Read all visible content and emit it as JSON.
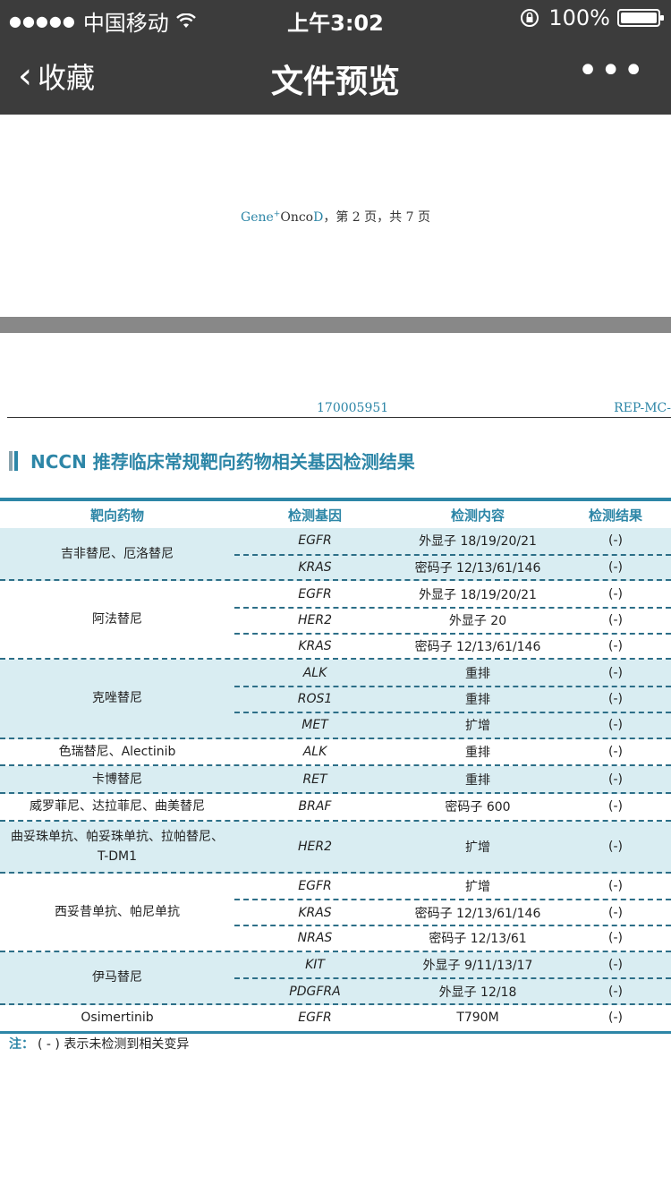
{
  "status": {
    "signal": "●●●●●",
    "carrier": "中国移动",
    "time": "上午3:02",
    "battery": "100%",
    "battery_level": 1.0
  },
  "nav": {
    "back_label": "收藏",
    "title": "文件预览"
  },
  "doc": {
    "footer_gene": "Gene",
    "footer_plus": "+",
    "footer_onco": "Onco",
    "footer_d": "D",
    "footer_page": "，第 2 页，共 7 页",
    "code_left": "170005951",
    "code_right": "REP-MC-",
    "section_title": "NCCN  推荐临床常规靶向药物相关基因检测结果",
    "headers": [
      "靶向药物",
      "检测基因",
      "检测内容",
      "检测结果"
    ],
    "groups": [
      {
        "drug": "吉非替尼、厄洛替尼",
        "shade": true,
        "rows": [
          {
            "gene": "EGFR",
            "content": "外显子 18/19/20/21",
            "result": "(-)"
          },
          {
            "gene": "KRAS",
            "content": "密码子 12/13/61/146",
            "result": "(-)"
          }
        ]
      },
      {
        "drug": "阿法替尼",
        "shade": false,
        "rows": [
          {
            "gene": "EGFR",
            "content": "外显子 18/19/20/21",
            "result": "(-)"
          },
          {
            "gene": "HER2",
            "content": "外显子 20",
            "result": "(-)"
          },
          {
            "gene": "KRAS",
            "content": "密码子 12/13/61/146",
            "result": "(-)"
          }
        ]
      },
      {
        "drug": "克唑替尼",
        "shade": true,
        "rows": [
          {
            "gene": "ALK",
            "content": "重排",
            "result": "(-)"
          },
          {
            "gene": "ROS1",
            "content": "重排",
            "result": "(-)"
          },
          {
            "gene": "MET",
            "content": "扩增",
            "result": "(-)"
          }
        ]
      },
      {
        "drug": "色瑞替尼、Alectinib",
        "shade": false,
        "rows": [
          {
            "gene": "ALK",
            "content": "重排",
            "result": "(-)"
          }
        ]
      },
      {
        "drug": "卡博替尼",
        "shade": true,
        "rows": [
          {
            "gene": "RET",
            "content": "重排",
            "result": "(-)"
          }
        ]
      },
      {
        "drug": "威罗菲尼、达拉菲尼、曲美替尼",
        "shade": false,
        "rows": [
          {
            "gene": "BRAF",
            "content": "密码子 600",
            "result": "(-)"
          }
        ]
      },
      {
        "drug": "曲妥珠单抗、帕妥珠单抗、拉帕替尼、T-DM1",
        "shade": true,
        "tall": true,
        "rows": [
          {
            "gene": "HER2",
            "content": "扩增",
            "result": "(-)"
          }
        ]
      },
      {
        "drug": "西妥昔单抗、帕尼单抗",
        "shade": false,
        "rows": [
          {
            "gene": "EGFR",
            "content": "扩增",
            "result": "(-)"
          },
          {
            "gene": "KRAS",
            "content": "密码子 12/13/61/146",
            "result": "(-)"
          },
          {
            "gene": "NRAS",
            "content": "密码子 12/13/61",
            "result": "(-)"
          }
        ]
      },
      {
        "drug": "伊马替尼",
        "shade": true,
        "rows": [
          {
            "gene": "KIT",
            "content": "外显子 9/11/13/17",
            "result": "(-)"
          },
          {
            "gene": "PDGFRA",
            "content": "外显子 12/18",
            "result": "(-)"
          }
        ]
      },
      {
        "drug": "Osimertinib",
        "shade": false,
        "last": true,
        "rows": [
          {
            "gene": "EGFR",
            "content": "T790M",
            "result": "(-)"
          }
        ]
      }
    ],
    "note_label": "注：",
    "note_text": "( - ) 表示未检测到相关变异"
  }
}
